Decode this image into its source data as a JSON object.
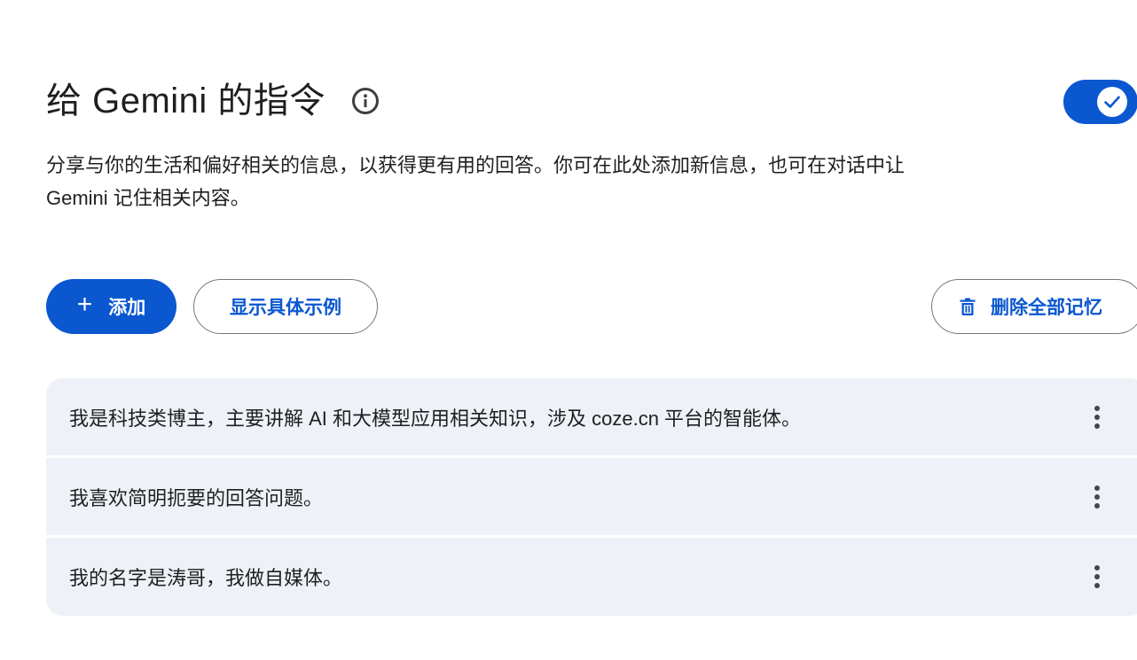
{
  "header": {
    "title": "给 Gemini 的指令",
    "info_icon": "info-icon",
    "toggle_on": true
  },
  "description": "分享与你的生活和偏好相关的信息，以获得更有用的回答。你可在此处添加新信息，也可在对话中让 Gemini 记住相关内容。",
  "actions": {
    "add_icon": "+",
    "add_label": "添加",
    "examples_label": "显示具体示例",
    "delete_all_label": "删除全部记忆",
    "delete_icon": "trash-icon"
  },
  "memories": [
    {
      "text": "我是科技类博主，主要讲解 AI 和大模型应用相关知识，涉及 coze.cn 平台的智能体。"
    },
    {
      "text": "我喜欢简明扼要的回答问题。"
    },
    {
      "text": "我的名字是涛哥，我做自媒体。"
    }
  ],
  "colors": {
    "accent": "#0b57d0",
    "item_bg": "#eef1f7",
    "text": "#1f1f1f",
    "outline": "#747775"
  }
}
